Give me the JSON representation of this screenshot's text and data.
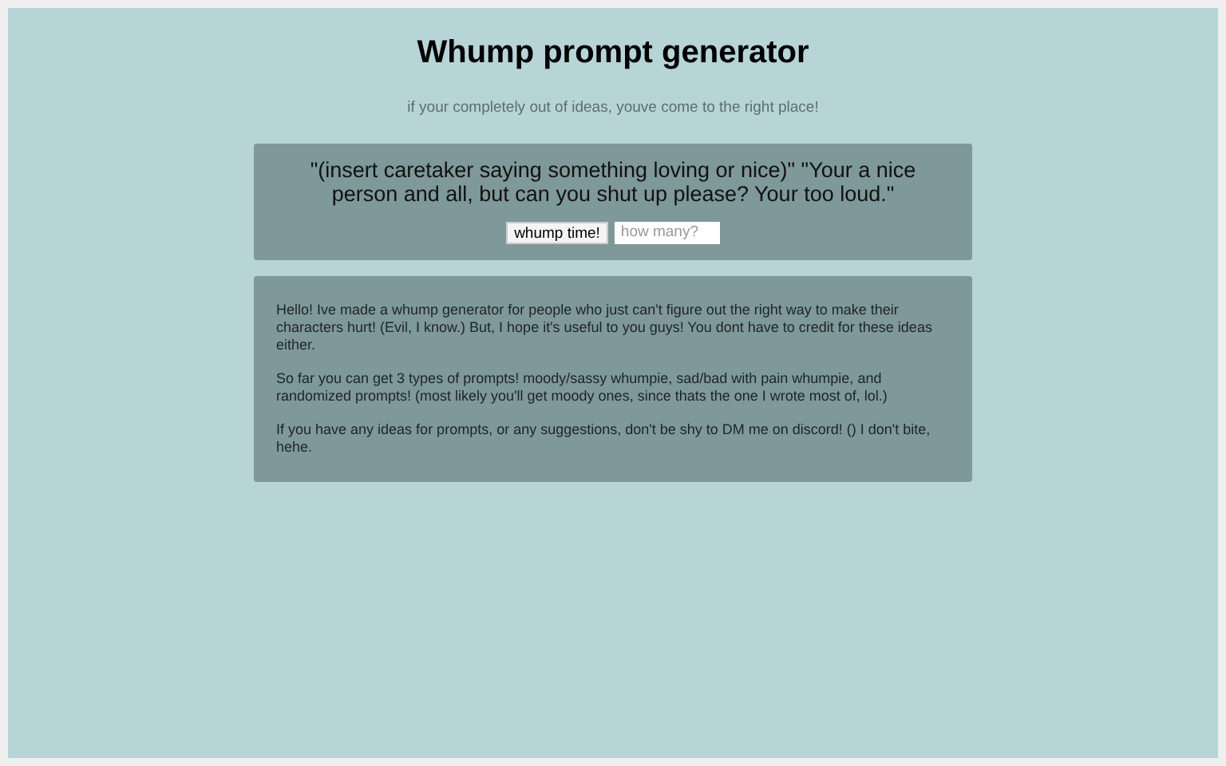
{
  "title": "Whump prompt generator",
  "subtitle": "if your completely out of ideas, youve come to the right place!",
  "prompt": "\"(insert caretaker saying something loving or nice)\" \"Your a nice person and all, but can you shut up please? Your too loud.\"",
  "button": "whump time!",
  "count_field": {
    "placeholder": "how many?"
  },
  "info_paragraphs": [
    "Hello! Ive made a whump generator for people who just can't figure out the right way to make their characters hurt! (Evil, I know.) But, I hope it's useful to you guys! You dont have to credit for these ideas either.",
    "So far you can get 3 types of prompts! moody/sassy whumpie, sad/bad with pain whumpie, and randomized prompts! (most likely you'll get moody ones, since thats the one I wrote most of, lol.)",
    "If you have any ideas for prompts, or any suggestions, don't be shy to DM me on discord! () I don't bite, hehe."
  ]
}
